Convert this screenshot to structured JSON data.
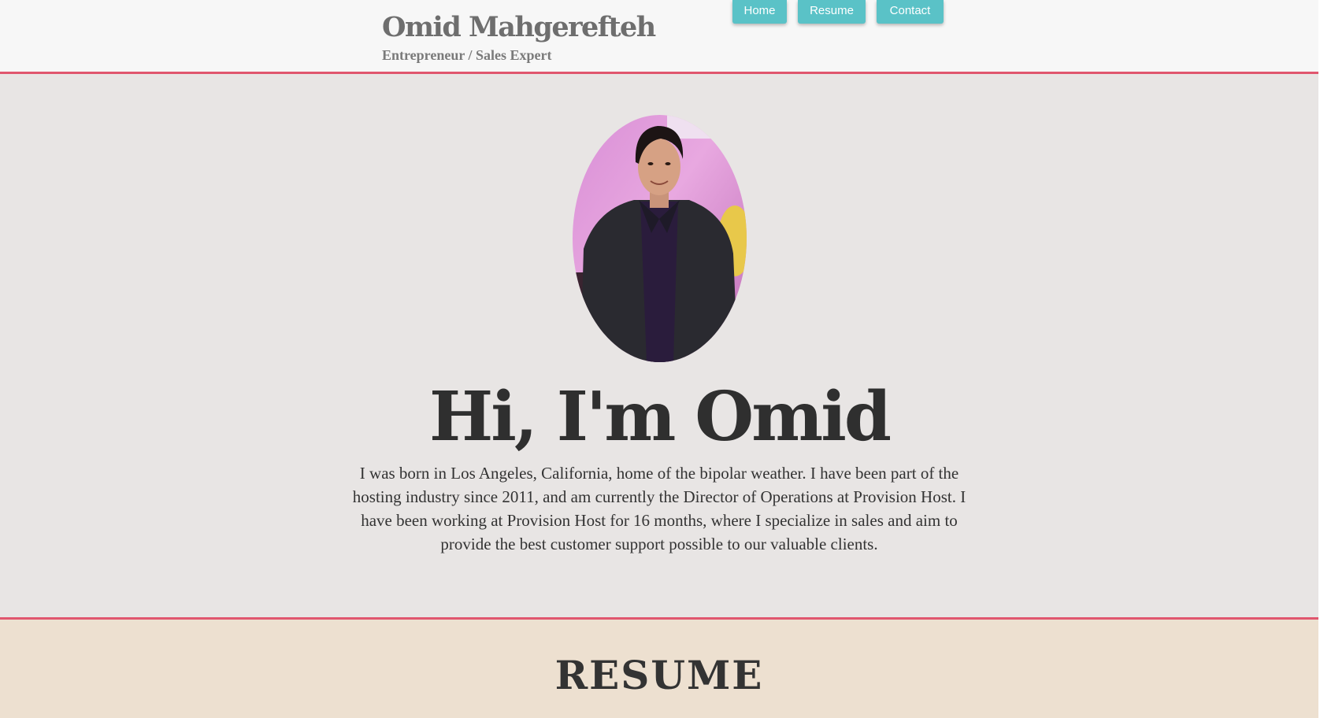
{
  "header": {
    "title": "Omid Mahgerefteh",
    "tagline": "Entrepreneur / Sales Expert",
    "nav": [
      {
        "label": "Home"
      },
      {
        "label": "Resume"
      },
      {
        "label": "Contact"
      }
    ]
  },
  "hero": {
    "heading": "Hi, I'm Omid",
    "bio": "I was born in Los Angeles, California, home of the bipolar weather. I have been part of the hosting industry since 2011, and am currently the Director of Operations at Provision Host. I have been working at Provision Host for 16 months, where I specialize in sales and aim to provide the best customer support possible to our valuable clients."
  },
  "resume": {
    "heading": "RESUME"
  },
  "colors": {
    "accent_line": "#e0566e",
    "nav_button": "#5ac2c7",
    "hero_bg": "#e8e5e4",
    "resume_bg": "#ede0d0",
    "header_bg": "#f7f7f7"
  }
}
